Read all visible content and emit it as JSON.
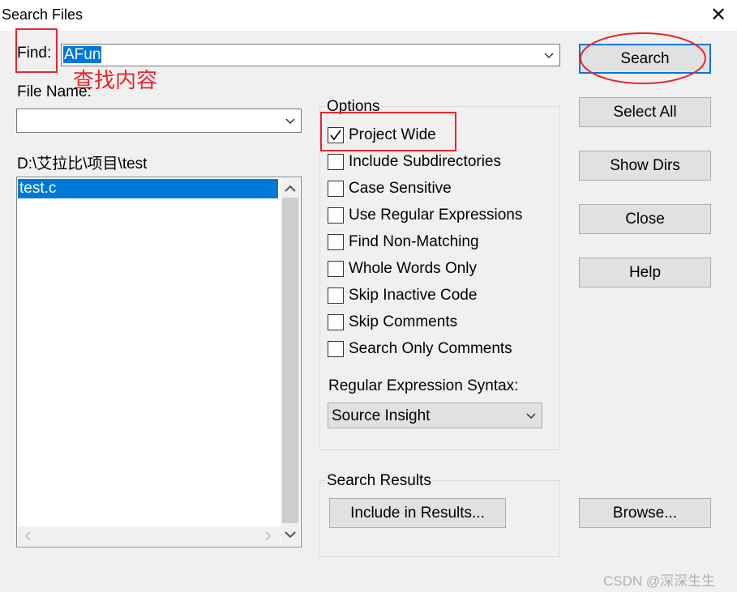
{
  "window": {
    "title": "Search Files",
    "close_glyph": "✕"
  },
  "find": {
    "label": "Find:",
    "value": "AFun"
  },
  "annotation_text": "查找内容",
  "file_name": {
    "label": "File Name:",
    "value": ""
  },
  "path": "D:\\艾拉比\\项目\\test",
  "file_list": {
    "items": [
      "test.c"
    ],
    "selected_index": 0
  },
  "options": {
    "label": "Options",
    "checkboxes": [
      {
        "label": "Project Wide",
        "checked": true
      },
      {
        "label": "Include Subdirectories",
        "checked": false
      },
      {
        "label": "Case Sensitive",
        "checked": false
      },
      {
        "label": "Use Regular Expressions",
        "checked": false
      },
      {
        "label": "Find Non-Matching",
        "checked": false
      },
      {
        "label": "Whole Words Only",
        "checked": false
      },
      {
        "label": "Skip Inactive Code",
        "checked": false
      },
      {
        "label": "Skip Comments",
        "checked": false
      },
      {
        "label": "Search Only Comments",
        "checked": false
      }
    ],
    "regex_syntax_label": "Regular Expression Syntax:",
    "regex_syntax_value": "Source Insight"
  },
  "search_results": {
    "label": "Search Results",
    "button": "Include in Results..."
  },
  "buttons": {
    "search": "Search",
    "select_all": "Select All",
    "show_dirs": "Show Dirs",
    "close": "Close",
    "help": "Help",
    "browse": "Browse..."
  },
  "watermark": "CSDN @深深生生",
  "colors": {
    "selection": "#0078d7",
    "annotation_red": "#e8262c",
    "dialog_bg": "#f0f0f0"
  }
}
